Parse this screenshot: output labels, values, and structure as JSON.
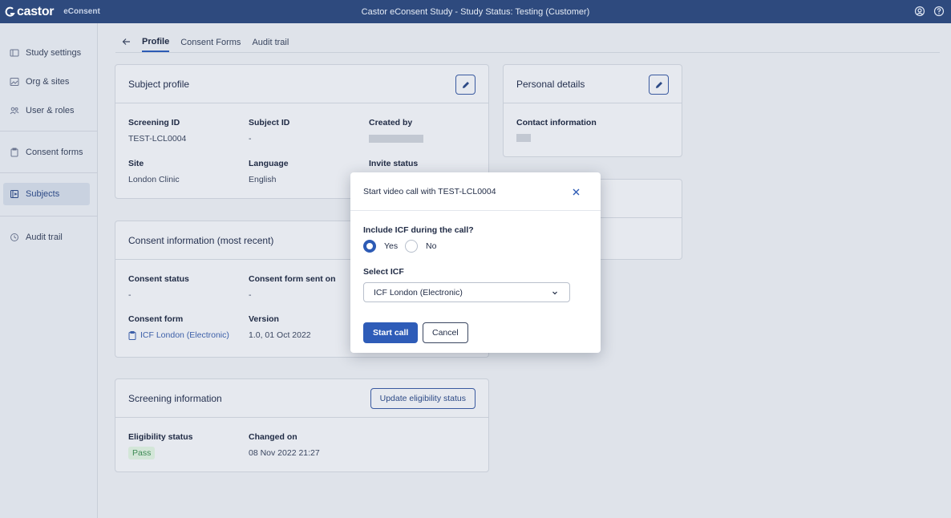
{
  "topbar": {
    "logo": "castor",
    "product": "eConsent",
    "title": "Castor eConsent Study  - Study Status: Testing (Customer)",
    "icons": [
      "user-circle-icon",
      "help-icon"
    ]
  },
  "sidebar": {
    "items": [
      {
        "label": "Study settings",
        "icon": "settings-panel-icon"
      },
      {
        "label": "Org & sites",
        "icon": "image-icon"
      },
      {
        "label": "User & roles",
        "icon": "users-icon"
      },
      {
        "label": "Consent forms",
        "icon": "clipboard-icon"
      },
      {
        "label": "Subjects",
        "icon": "subjects-icon"
      },
      {
        "label": "Audit trail",
        "icon": "history-icon"
      }
    ]
  },
  "tabs": {
    "items": [
      "Profile",
      "Consent Forms",
      "Audit trail"
    ],
    "active": "Profile"
  },
  "subject_profile": {
    "title": "Subject profile",
    "screening_id_label": "Screening ID",
    "screening_id": "TEST-LCL0004",
    "subject_id_label": "Subject ID",
    "subject_id": "-",
    "created_by_label": "Created by",
    "site_label": "Site",
    "site": "London Clinic",
    "language_label": "Language",
    "language": "English",
    "invite_status_label": "Invite status"
  },
  "personal_details": {
    "title": "Personal details",
    "contact_label": "Contact information"
  },
  "consent_info": {
    "title": "Consent information (most recent)",
    "status_label": "Consent status",
    "status": "-",
    "sent_on_label": "Consent form sent on",
    "sent_on": "-",
    "form_label": "Consent form",
    "form": "ICF London (Electronic)",
    "version_label": "Version",
    "version": "1.0, 01 Oct 2022"
  },
  "screening_info": {
    "title": "Screening information",
    "update_button": "Update eligibility status",
    "eligibility_label": "Eligibility status",
    "eligibility": "Pass",
    "changed_on_label": "Changed on",
    "changed_on": "08 Nov 2022 21:27"
  },
  "modal": {
    "title": "Start video call with TEST-LCL0004",
    "question": "Include ICF during the call?",
    "option_yes": "Yes",
    "option_no": "No",
    "selected": "Yes",
    "select_label": "Select ICF",
    "select_value": "ICF London (Electronic)",
    "start_button": "Start call",
    "cancel_button": "Cancel"
  },
  "colors": {
    "topbar": "#2e4a7e",
    "primary": "#2e5cb8",
    "pass": "#3d8a55"
  }
}
